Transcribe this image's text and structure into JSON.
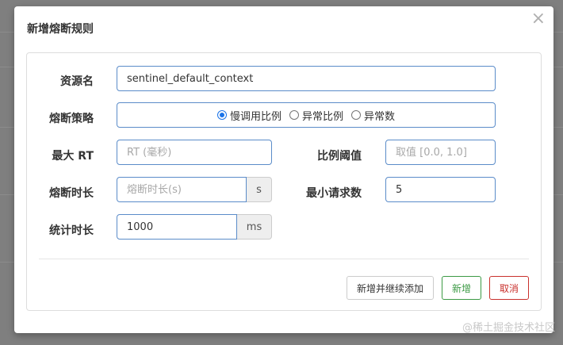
{
  "modal": {
    "title": "新增熔断规则",
    "close_label": "×"
  },
  "form": {
    "resource_label": "资源名",
    "resource_value": "sentinel_default_context",
    "strategy_label": "熔断策略",
    "strategy_options": [
      {
        "label": "慢调用比例",
        "checked": true
      },
      {
        "label": "异常比例",
        "checked": false
      },
      {
        "label": "异常数",
        "checked": false
      }
    ],
    "max_rt_label": "最大 RT",
    "max_rt_placeholder": "RT (毫秒)",
    "ratio_threshold_label": "比例阈值",
    "ratio_threshold_placeholder": "取值 [0.0, 1.0]",
    "break_duration_label": "熔断时长",
    "break_duration_placeholder": "熔断时长(s)",
    "break_duration_unit": "s",
    "min_requests_label": "最小请求数",
    "min_requests_value": "5",
    "stat_duration_label": "统计时长",
    "stat_duration_value": "1000",
    "stat_duration_unit": "ms"
  },
  "buttons": {
    "add_continue": "新增并继续添加",
    "add": "新增",
    "cancel": "取消"
  },
  "watermark": "@稀土掘金技术社区",
  "colors": {
    "input_border": "#5b8cc9",
    "success": "#3c9a45",
    "danger": "#c9302c",
    "radio_checked": "#1a73e8"
  }
}
